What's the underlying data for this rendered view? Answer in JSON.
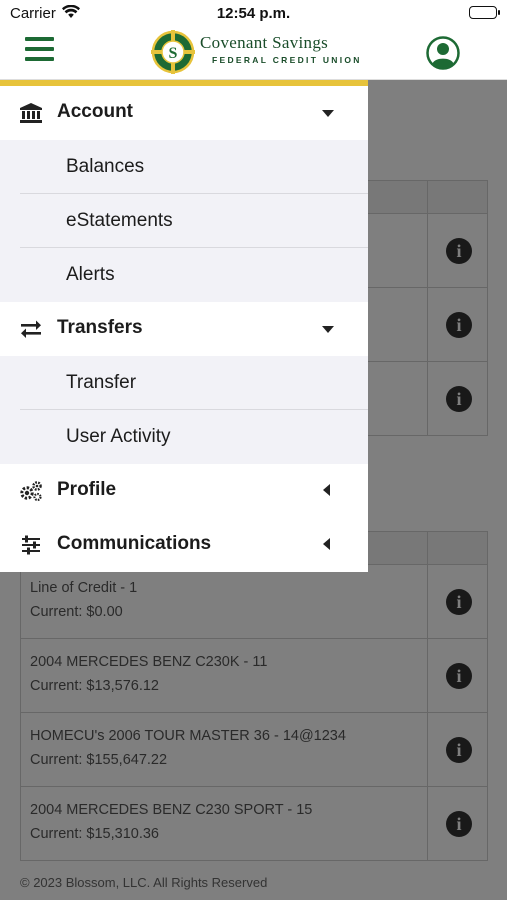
{
  "status_bar": {
    "carrier": "Carrier",
    "time": "12:54 p.m."
  },
  "header": {
    "logo_title": "Covenant Savings",
    "logo_subtitle": "FEDERAL CREDIT UNION",
    "menu_icon": "hamburger-icon",
    "profile_icon": "user-circle-icon"
  },
  "colors": {
    "brand_green": "#1d6a34",
    "accent_gold": "#e7c33b",
    "submenu_bg": "#f2f2f7"
  },
  "menu": {
    "account": {
      "label": "Account",
      "icon": "bank-icon",
      "expanded": true
    },
    "account_items": [
      "Balances",
      "eStatements",
      "Alerts"
    ],
    "transfers": {
      "label": "Transfers",
      "icon": "arrows-exchange-icon",
      "expanded": true
    },
    "transfer_items": [
      "Transfer",
      "User Activity"
    ],
    "profile": {
      "label": "Profile",
      "icon": "gears-icon",
      "expanded": false
    },
    "communications": {
      "label": "Communications",
      "icon": "sliders-icon",
      "expanded": false
    }
  },
  "accounts": [
    {
      "name": "Line of Credit - 1",
      "current": "Current: $0.00"
    },
    {
      "name": "2004 MERCEDES BENZ C230K - 11",
      "current": "Current: $13,576.12"
    },
    {
      "name": "HOMECU's 2006 TOUR MASTER 36 - 14@1234",
      "current": "Current: $155,647.22"
    },
    {
      "name": "2004 MERCEDES BENZ C230 SPORT - 15",
      "current": "Current: $15,310.36"
    }
  ],
  "info_icon_glyph": "i",
  "footer": "© 2023 Blossom, LLC. All Rights Reserved"
}
